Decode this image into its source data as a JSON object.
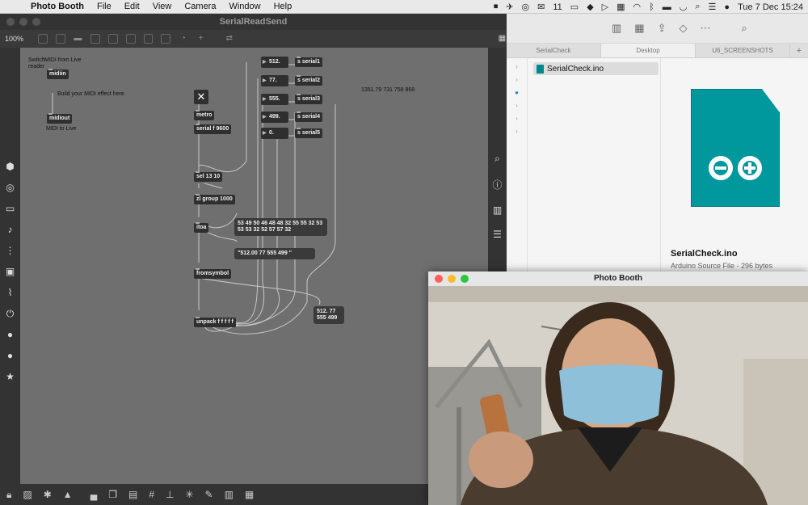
{
  "menubar": {
    "app_name": "Photo Booth",
    "menus": [
      "File",
      "Edit",
      "View",
      "Camera",
      "Window",
      "Help"
    ],
    "notification_count": "11",
    "date_time": "Tue 7 Dec  15:24"
  },
  "max": {
    "window_title": "SerialReadSend",
    "zoom": "100%",
    "comments": {
      "switch_reader": "Switch reader",
      "midi_from_live": "MIDI from Live",
      "build_effect": "Build your MIDI effect here",
      "midi_to_live": "MIDI to Live",
      "readout": "1351.79 731 758 868"
    },
    "objects": {
      "midiin": "midiin",
      "midiout": "midiout",
      "metro": "metro",
      "serial": "serial f 9600",
      "sel": "sel 13 10",
      "zl": "zl group 1000",
      "itoa": "itoa",
      "fromsymbol": "fromsymbol",
      "unpack": "unpack f f f f f",
      "s1": "s serial1",
      "s2": "s serial2",
      "s3": "s serial3",
      "s4": "s serial4",
      "s5": "s serial5"
    },
    "numbers": [
      "512.",
      "77.",
      "555.",
      "499.",
      "0."
    ],
    "messages": {
      "bytes": "53 49 50 46 48 48 32 55 55 32 53 53 53 32 52 57 57 32",
      "string": "\"512.00 77 555 499 \"",
      "result": "512. 77 555 499"
    }
  },
  "finder": {
    "tabs": [
      "SerialCheck",
      "Desktop",
      "U6_SCREENSHOTS"
    ],
    "file_name": "SerialCheck.ino",
    "preview_title": "SerialCheck.ino",
    "preview_subtitle": "Arduino Source File - 296 bytes"
  },
  "photobooth": {
    "window_title": "Photo Booth"
  }
}
